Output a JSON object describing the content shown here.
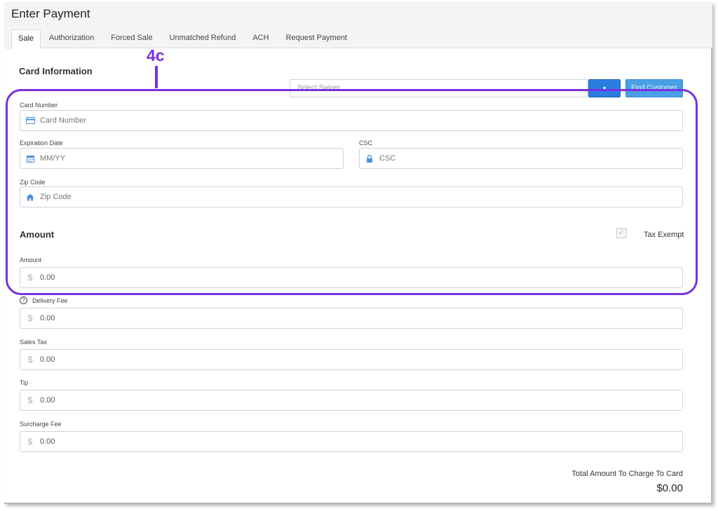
{
  "header": {
    "title": "Enter Payment",
    "tabs": [
      "Sale",
      "Authorization",
      "Forced Sale",
      "Unmatched Refund",
      "ACH",
      "Request Payment"
    ]
  },
  "annotation": {
    "label": "4c",
    "color": "#7a2fe0"
  },
  "card": {
    "section_title": "Card Information",
    "swiper_placeholder": "Select Swiper",
    "swiper_button": "▾",
    "find_customer": "Find Customer",
    "card_number_label": "Card Number",
    "card_number_placeholder": "Card Number",
    "expiration_label": "Expiration Date",
    "expiration_placeholder": "MM/YY",
    "csc_label": "CSC",
    "csc_placeholder": "CSC",
    "zip_label": "Zip Code",
    "zip_placeholder": "Zip Code"
  },
  "amount": {
    "section_title": "Amount",
    "tax_exempt_label": "Tax Exempt",
    "tax_exempt_checked": true,
    "amount_label": "Amount",
    "amount_value": "0.00",
    "delivery_fee_label": "Delivery Fee",
    "delivery_fee_value": "0.00",
    "sales_tax_label": "Sales Tax",
    "sales_tax_value": "0.00",
    "tip_label": "Tip",
    "tip_value": "0.00",
    "surcharge_label": "Surcharge Fee",
    "surcharge_value": "0.00",
    "currency_symbol": "$"
  },
  "total": {
    "label": "Total Amount To Charge To Card",
    "value": "$0.00"
  },
  "colors": {
    "accent": "#2a7de1",
    "icon_blue": "#4a90d9",
    "annotation": "#7a2fe0"
  }
}
